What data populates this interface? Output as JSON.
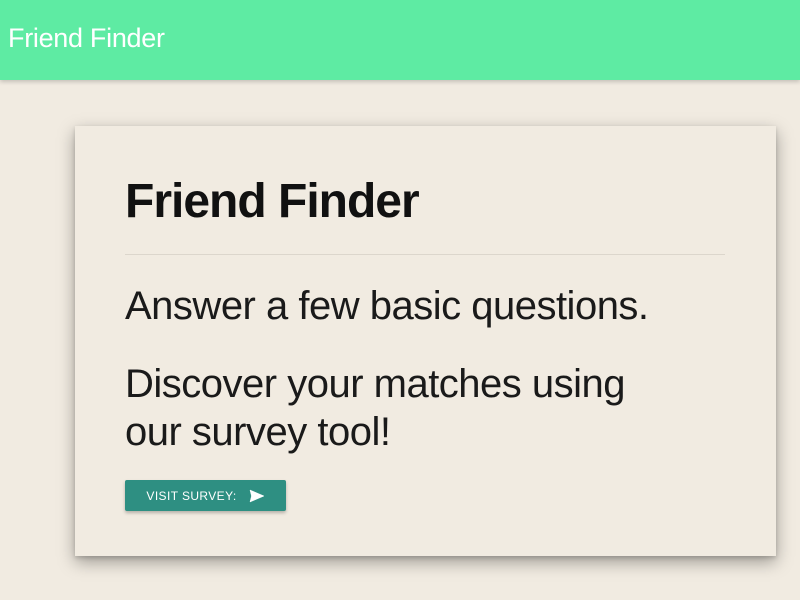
{
  "navbar": {
    "brand": "Friend Finder",
    "background": "#5eeba3"
  },
  "card": {
    "title": "Friend Finder",
    "lead_1": "Answer a few basic questions.",
    "lead_2": "Discover your matches using our survey tool!",
    "button": {
      "label": "VISIT SURVEY:",
      "icon": "send-icon",
      "color": "#2e8f82"
    }
  }
}
